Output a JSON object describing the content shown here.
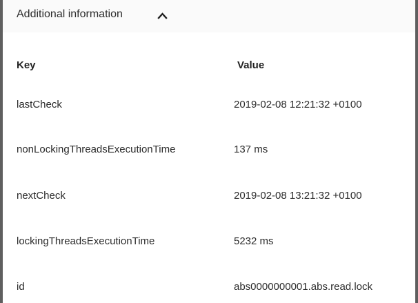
{
  "section": {
    "title": "Additional information",
    "toggle_icon": "chevron-up-icon"
  },
  "table": {
    "headers": {
      "key": "Key",
      "value": "Value"
    },
    "rows": [
      {
        "key": "lastCheck",
        "value": "2019-02-08 12:21:32 +0100"
      },
      {
        "key": "nonLockingThreadsExecutionTime",
        "value": "137 ms"
      },
      {
        "key": "nextCheck",
        "value": "2019-02-08 13:21:32 +0100"
      },
      {
        "key": "lockingThreadsExecutionTime",
        "value": "5232 ms"
      },
      {
        "key": "id",
        "value": "abs0000000001.abs.read.lock"
      }
    ]
  },
  "colors": {
    "border": "#5f5f5f",
    "header_background": "#fafafa",
    "text": "#222222"
  }
}
